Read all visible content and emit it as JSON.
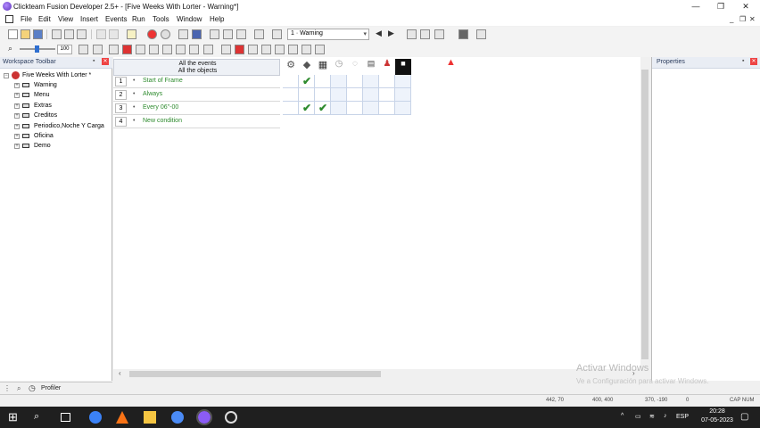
{
  "window": {
    "title": "Clickteam Fusion Developer 2.5+ - [Five Weeks With Lorter - Warning*]",
    "controls": {
      "minimize": "—",
      "restore": "❐",
      "close": "✕"
    }
  },
  "menu": {
    "items": [
      "File",
      "Edit",
      "View",
      "Insert",
      "Events",
      "Run",
      "Tools",
      "Window",
      "Help"
    ],
    "mdi_controls": {
      "minimize": "_",
      "restore": "❐",
      "close": "✕"
    }
  },
  "toolbar": {
    "frame_selector": "1 · Warning",
    "zoom_value": "100"
  },
  "workspace": {
    "title": "Workspace Toolbar",
    "app_name": "Five Weeks With Lorter *",
    "frames": [
      "Warning",
      "Menu",
      "Extras",
      "Creditos",
      "Periodico,Noche Y Carga",
      "Oficina",
      "Demo"
    ]
  },
  "event_editor": {
    "header_line1": "All the events",
    "header_line2": "All the objects",
    "events": [
      {
        "num": "1",
        "text": "Start of Frame",
        "color": "#2e8b2e"
      },
      {
        "num": "2",
        "text": "Always",
        "color": "#2e8b2e"
      },
      {
        "num": "3",
        "text": "Every 06\"-00",
        "color": "#2e8b2e"
      },
      {
        "num": "4",
        "text": "New condition",
        "color": "#2e8b2e"
      }
    ]
  },
  "properties": {
    "title": "Properties"
  },
  "bottom_tabs": {
    "profiler": "Profiler"
  },
  "watermark": {
    "line1": "Activar Windows",
    "line2": "Ve a Configuración para activar Windows."
  },
  "statusbar": {
    "coords1": "442, 70",
    "coords2": "400, 400",
    "coords3": "370, -190",
    "coords4": "0",
    "caps": "CAP NUM"
  },
  "taskbar": {
    "time": "20:28",
    "date": "07-05-2023",
    "lang": "ESP"
  }
}
